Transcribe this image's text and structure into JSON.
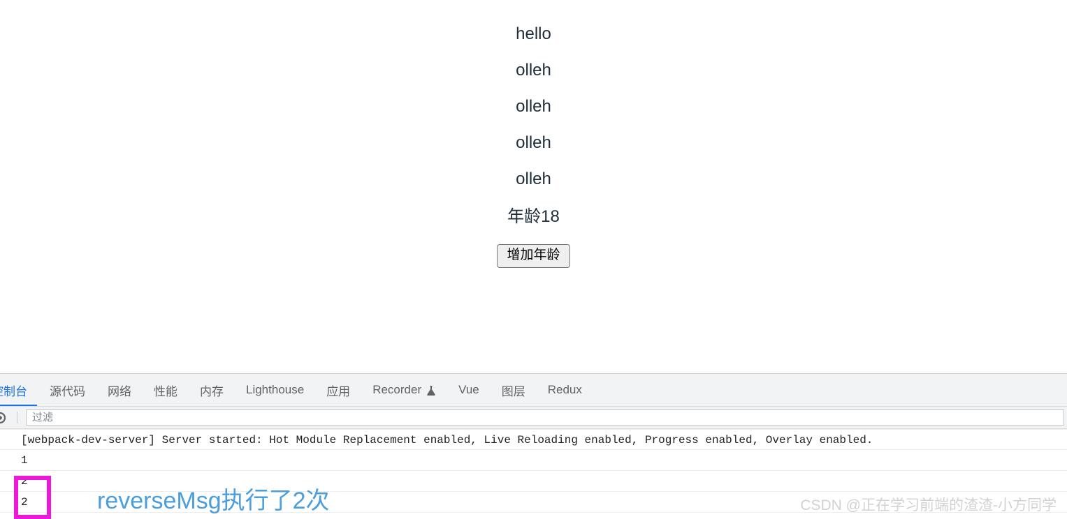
{
  "page": {
    "lines": [
      {
        "text": "hello"
      },
      {
        "text": "olleh"
      },
      {
        "text": "olleh"
      },
      {
        "text": "olleh"
      },
      {
        "text": "olleh"
      },
      {
        "text": "年龄18"
      }
    ],
    "button_label": "增加年龄"
  },
  "devtools": {
    "tabs": [
      {
        "label": "控制台",
        "active": true,
        "icon": ""
      },
      {
        "label": "源代码",
        "active": false,
        "icon": ""
      },
      {
        "label": "网络",
        "active": false,
        "icon": ""
      },
      {
        "label": "性能",
        "active": false,
        "icon": ""
      },
      {
        "label": "内存",
        "active": false,
        "icon": ""
      },
      {
        "label": "Lighthouse",
        "active": false,
        "icon": ""
      },
      {
        "label": "应用",
        "active": false,
        "icon": ""
      },
      {
        "label": "Recorder",
        "active": false,
        "icon": "flask-icon"
      },
      {
        "label": "Vue",
        "active": false,
        "icon": ""
      },
      {
        "label": "图层",
        "active": false,
        "icon": ""
      },
      {
        "label": "Redux",
        "active": false,
        "icon": ""
      }
    ],
    "filter": {
      "icon": "console-settings-icon",
      "placeholder": "过滤",
      "value": ""
    },
    "console_rows": [
      {
        "text": "[webpack-dev-server] Server started: Hot Module Replacement enabled, Live Reloading enabled, Progress enabled, Overlay enabled."
      },
      {
        "text": "1"
      },
      {
        "text": "2"
      },
      {
        "text": "2"
      }
    ]
  },
  "annotations": {
    "callout_text": "reverseMsg执行了2次",
    "callout_color": "#4a9ede",
    "highlight_box_color": "#ec19d8",
    "watermark": "CSDN @正在学习前端的渣渣-小方同学"
  }
}
